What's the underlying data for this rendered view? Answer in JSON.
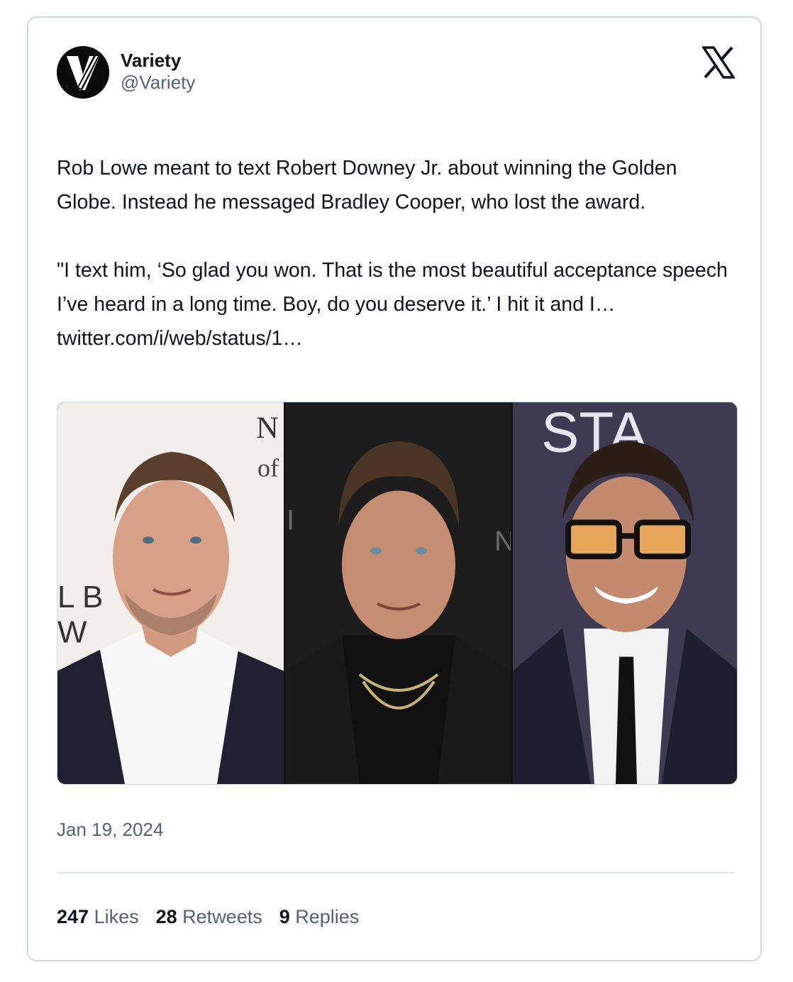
{
  "author": {
    "display_name": "Variety",
    "handle": "@Variety",
    "avatar_icon": "variety-v-logo-icon"
  },
  "platform_icon": "x-logo-icon",
  "tweet": {
    "paragraph_1": "Rob Lowe meant to text Robert Downey Jr. about winning the Golden Globe. Instead he messaged Bradley Cooper, who lost the award.",
    "paragraph_2_text": "\"I text him, ‘So glad you won. That is the most beautiful acceptance speech I’ve heard in a long time. Boy, do you deserve it.’ I hit it and I… ",
    "paragraph_2_link": "twitter.com/i/web/status/1…"
  },
  "media": {
    "photos": [
      {
        "backdrop_text": "N\nof\nL B\nW"
      },
      {
        "backdrop_text": "I\nN"
      },
      {
        "backdrop_text": "STA"
      }
    ]
  },
  "date": "Jan 19, 2024",
  "stats": {
    "likes_count": "247",
    "likes_label": "Likes",
    "retweets_count": "28",
    "retweets_label": "Retweets",
    "replies_count": "9",
    "replies_label": "Replies"
  },
  "colors": {
    "text_primary": "#0f1419",
    "text_secondary": "#536471",
    "border": "#cfd9de"
  }
}
